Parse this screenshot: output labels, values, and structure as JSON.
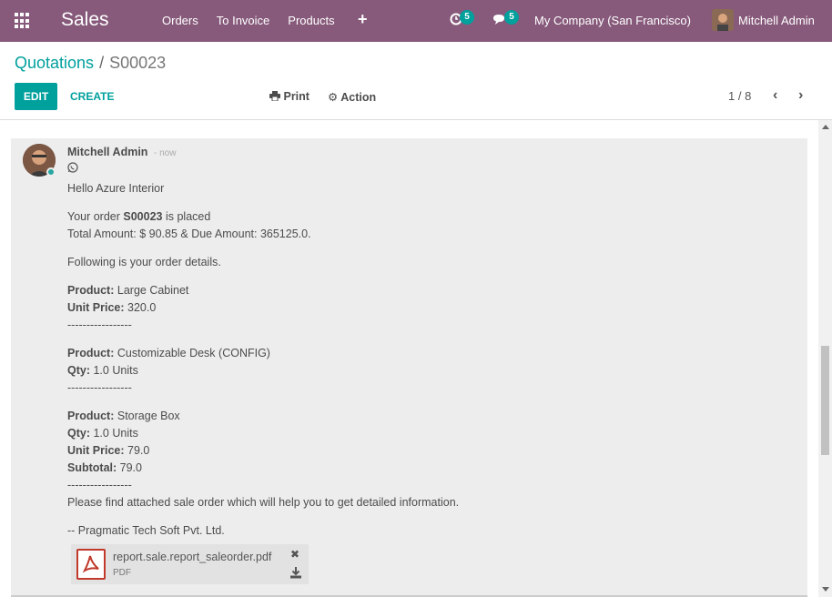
{
  "navbar": {
    "app_title": "Sales",
    "menu": [
      "Orders",
      "To Invoice",
      "Products"
    ],
    "activity_count": "5",
    "messages_count": "5",
    "company": "My Company (San Francisco)",
    "user": "Mitchell Admin",
    "icons": [
      "apps-grid-icon",
      "plus-icon",
      "clock-icon",
      "chat-icon"
    ]
  },
  "breadcrumb": {
    "parent": "Quotations",
    "separator": "/",
    "current": "S00023"
  },
  "toolbar": {
    "edit_label": "EDIT",
    "create_label": "CREATE",
    "print_label": "Print",
    "action_label": "Action",
    "pager": "1 / 8"
  },
  "message": {
    "author": "Mitchell Admin",
    "date": "- now",
    "greeting": "Hello Azure Interior",
    "order_prefix": "Your order ",
    "order_ref": "S00023",
    "order_suffix": " is placed",
    "totals": "Total Amount: $ 90.85 & Due Amount: 365125.0.",
    "details_intro": "Following is your order details.",
    "label_product": "Product:",
    "label_qty": "Qty:",
    "label_unit_price": "Unit Price:",
    "label_subtotal": "Subtotal:",
    "separator_line": "-----------------",
    "items": [
      {
        "product": "Large Cabinet",
        "unit_price": "320.0"
      },
      {
        "product": "Customizable Desk (CONFIG)",
        "qty": "1.0 Units"
      },
      {
        "product": "Storage Box",
        "qty": "1.0 Units",
        "unit_price": "79.0",
        "subtotal": "79.0"
      }
    ],
    "closing": "Please find attached sale order which will help you to get detailed information.",
    "signature": "-- Pragmatic Tech Soft Pvt. Ltd."
  },
  "attachment": {
    "name": "report.sale.report_saleorder.pdf",
    "type": "PDF"
  },
  "colors": {
    "navbar": "#875a7b",
    "accent": "#00a09d",
    "message_bg": "#ededed"
  }
}
